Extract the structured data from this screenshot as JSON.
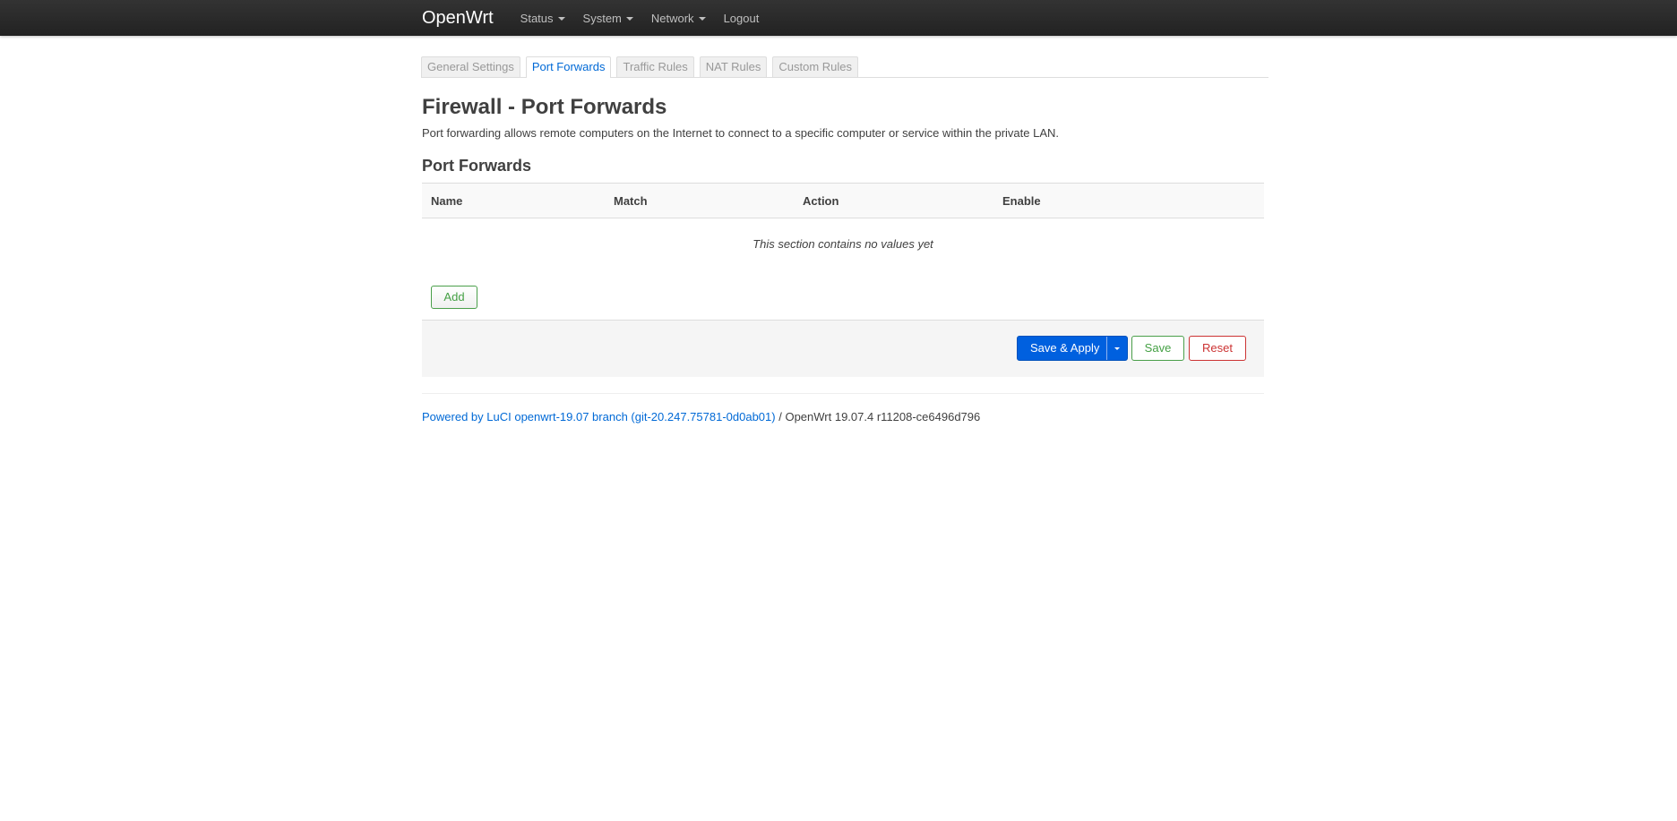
{
  "navbar": {
    "brand": "OpenWrt",
    "items": [
      {
        "label": "Status",
        "has_caret": true
      },
      {
        "label": "System",
        "has_caret": true
      },
      {
        "label": "Network",
        "has_caret": true
      },
      {
        "label": "Logout",
        "has_caret": false
      }
    ]
  },
  "tabs": [
    {
      "label": "General Settings",
      "active": false
    },
    {
      "label": "Port Forwards",
      "active": true
    },
    {
      "label": "Traffic Rules",
      "active": false
    },
    {
      "label": "NAT Rules",
      "active": false
    },
    {
      "label": "Custom Rules",
      "active": false
    }
  ],
  "page": {
    "title": "Firewall - Port Forwards",
    "description": "Port forwarding allows remote computers on the Internet to connect to a specific computer or service within the private LAN."
  },
  "section": {
    "title": "Port Forwards",
    "columns": [
      "Name",
      "Match",
      "Action",
      "Enable"
    ],
    "empty_message": "This section contains no values yet",
    "add_label": "Add"
  },
  "actions": {
    "save_apply_label": "Save & Apply",
    "save_label": "Save",
    "reset_label": "Reset"
  },
  "footer": {
    "link_text": "Powered by LuCI openwrt-19.07 branch (git-20.247.75781-0d0ab01)",
    "separator": " / ",
    "version_text": "OpenWrt 19.07.4 r11208-ce6496d796"
  },
  "colors": {
    "primary": "#0060df",
    "link": "#0069d6",
    "positive": "#44a044",
    "negative": "#cc3333",
    "navbar": "#222222"
  }
}
